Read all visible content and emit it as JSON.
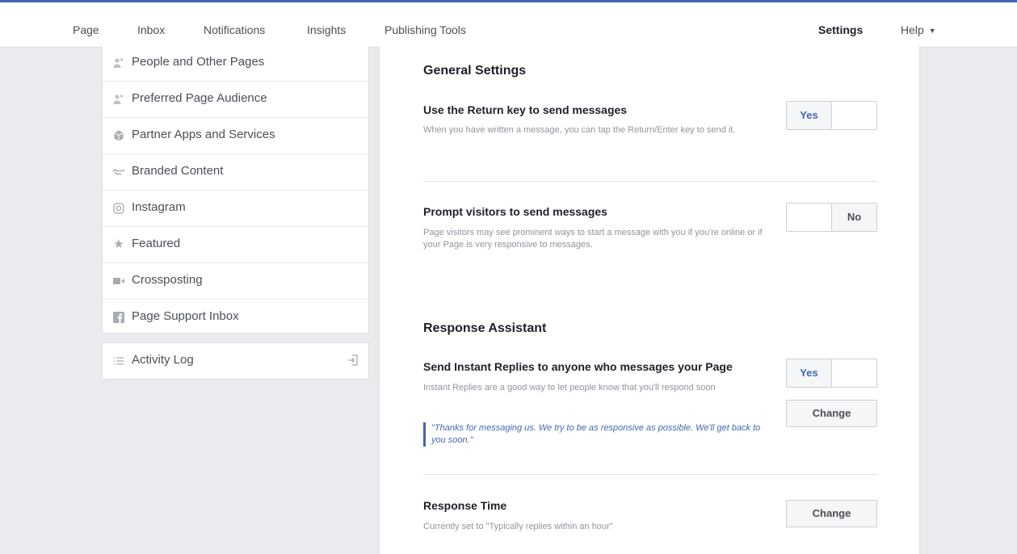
{
  "nav": {
    "page": "Page",
    "inbox": "Inbox",
    "notifications": "Notifications",
    "insights": "Insights",
    "publishing_tools": "Publishing Tools",
    "settings": "Settings",
    "help": "Help"
  },
  "sidebar": {
    "items": [
      {
        "label": "People and Other Pages",
        "icon": "people-icon"
      },
      {
        "label": "Preferred Page Audience",
        "icon": "people-icon"
      },
      {
        "label": "Partner Apps and Services",
        "icon": "cube-icon"
      },
      {
        "label": "Branded Content",
        "icon": "handshake-icon"
      },
      {
        "label": "Instagram",
        "icon": "instagram-icon"
      },
      {
        "label": "Featured",
        "icon": "star-icon"
      },
      {
        "label": "Crossposting",
        "icon": "video-camera-icon"
      },
      {
        "label": "Page Support Inbox",
        "icon": "facebook-icon"
      }
    ],
    "activity_log": {
      "label": "Activity Log",
      "icon": "list-icon"
    }
  },
  "general": {
    "title": "General Settings",
    "return_key": {
      "title": "Use the Return key to send messages",
      "desc": "When you have written a message, you can tap the Return/Enter key to send it.",
      "toggle": "Yes"
    },
    "prompt_visitors": {
      "title": "Prompt visitors to send messages",
      "desc": "Page visitors may see prominent ways to start a message with you if you're online or if your Page is very responsive to messages.",
      "toggle": "No"
    }
  },
  "response_assistant": {
    "title": "Response Assistant",
    "instant_replies": {
      "title": "Send Instant Replies to anyone who messages your Page",
      "desc": "Instant Replies are a good way to let people know that you'll respond soon",
      "toggle": "Yes",
      "button": "Change",
      "quote": "\"Thanks for messaging us. We try to be as responsive as possible. We'll get back to you soon.\""
    },
    "response_time": {
      "title": "Response Time",
      "desc": "Currently set to \"Typically replies within an hour\"",
      "button": "Change"
    }
  },
  "colors": {
    "accent": "#4267b2",
    "background": "#e9ebee"
  }
}
